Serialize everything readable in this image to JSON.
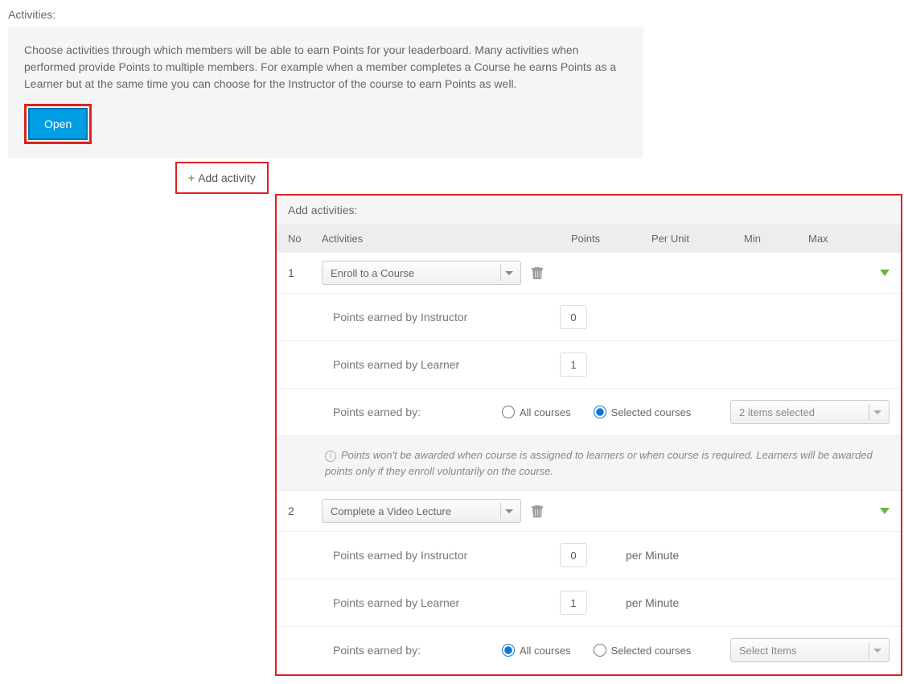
{
  "top": {
    "label": "Activities:",
    "description": "Choose activities through which members will be able to earn Points for your leaderboard. Many activities when performed provide Points to multiple members. For example when a member completes a Course he earns Points as a Learner but at the same time you can choose for the Instructor of the course to earn Points as well.",
    "open_label": "Open"
  },
  "add_activity_label": "Add activity",
  "panel": {
    "title": "Add activities:",
    "columns": {
      "no": "No",
      "activities": "Activities",
      "points": "Points",
      "per_unit": "Per Unit",
      "min": "Min",
      "max": "Max"
    },
    "activities": [
      {
        "no": "1",
        "dropdown": "Enroll to a Course",
        "detail_rows": [
          {
            "label": "Points earned by Instructor",
            "value": "0"
          },
          {
            "label": "Points earned by Learner",
            "value": "1"
          }
        ],
        "scope": {
          "label": "Points earned by:",
          "all_courses_label": "All courses",
          "selected_courses_label": "Selected courses",
          "selected": "selected",
          "dropdown": "2 items selected"
        },
        "note": "Points won't be awarded when course is assigned to learners or when course is required. Learners will be awarded points only if they enroll voluntarily on the course."
      },
      {
        "no": "2",
        "dropdown": "Complete a Video Lecture",
        "detail_rows": [
          {
            "label": "Points earned by Instructor",
            "value": "0",
            "unit": "per Minute"
          },
          {
            "label": "Points earned by Learner",
            "value": "1",
            "unit": "per Minute"
          }
        ],
        "scope": {
          "label": "Points earned by:",
          "all_courses_label": "All courses",
          "selected_courses_label": "Selected courses",
          "selected": "all",
          "dropdown": "Select Items"
        }
      }
    ]
  }
}
